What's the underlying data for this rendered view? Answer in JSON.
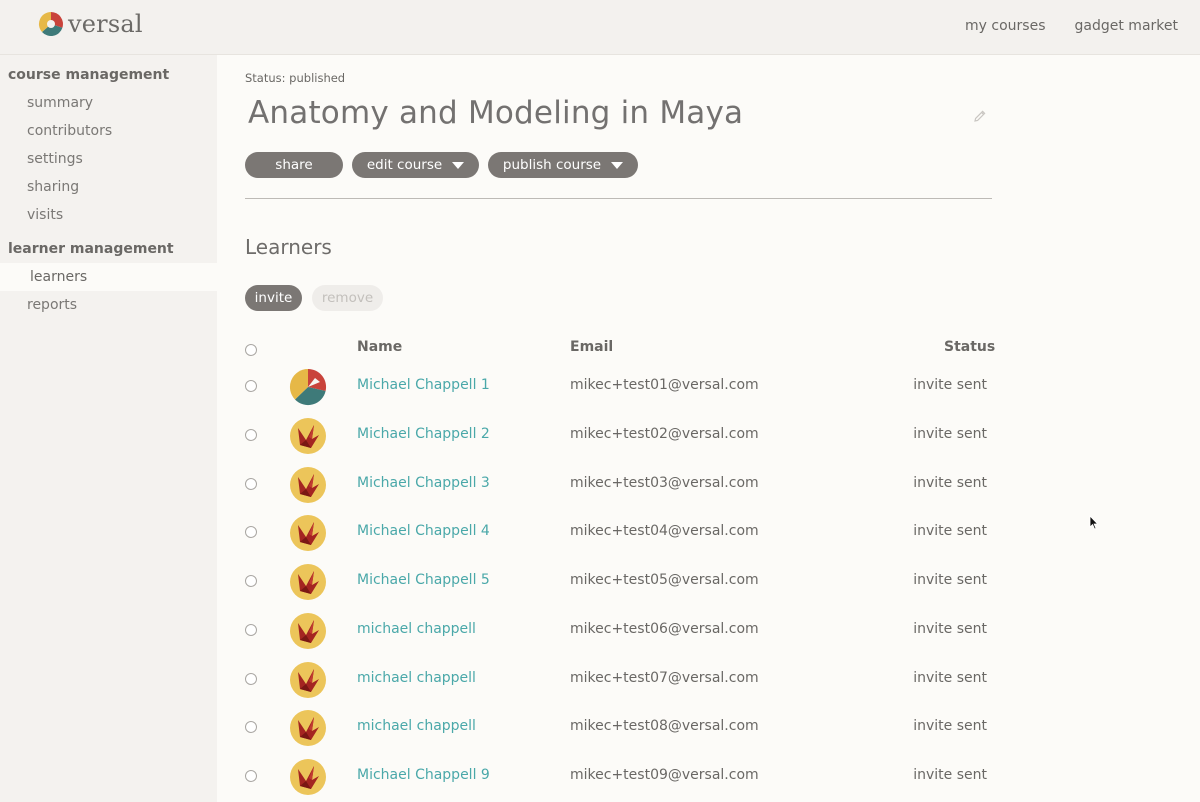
{
  "header": {
    "logo_text": "versal",
    "nav": [
      "my courses",
      "gadget market"
    ]
  },
  "sidebar": {
    "sections": [
      {
        "title": "course management",
        "items": [
          "summary",
          "contributors",
          "settings",
          "sharing",
          "visits"
        ]
      },
      {
        "title": "learner management",
        "items": [
          "learners",
          "reports"
        ]
      }
    ],
    "active_item": "learners"
  },
  "course": {
    "status": "Status: published",
    "title": "Anatomy and Modeling in Maya",
    "buttons": {
      "share": "share",
      "edit": "edit course",
      "publish": "publish course"
    }
  },
  "learners": {
    "title": "Learners",
    "invite_label": "invite",
    "remove_label": "remove",
    "columns": {
      "name": "Name",
      "email": "Email",
      "status": "Status"
    },
    "rows": [
      {
        "name": "Michael Chappell 1",
        "email": "mikec+test01@versal.com",
        "status": "invite sent",
        "avatar": "versal-logo"
      },
      {
        "name": "Michael Chappell 2",
        "email": "mikec+test02@versal.com",
        "status": "invite sent",
        "avatar": "origami-bird"
      },
      {
        "name": "Michael Chappell 3",
        "email": "mikec+test03@versal.com",
        "status": "invite sent",
        "avatar": "origami-bird"
      },
      {
        "name": "Michael Chappell 4",
        "email": "mikec+test04@versal.com",
        "status": "invite sent",
        "avatar": "origami-bird"
      },
      {
        "name": "Michael Chappell 5",
        "email": "mikec+test05@versal.com",
        "status": "invite sent",
        "avatar": "origami-bird"
      },
      {
        "name": "michael chappell",
        "email": "mikec+test06@versal.com",
        "status": "invite sent",
        "avatar": "origami-bird"
      },
      {
        "name": "michael chappell",
        "email": "mikec+test07@versal.com",
        "status": "invite sent",
        "avatar": "origami-bird"
      },
      {
        "name": "michael chappell",
        "email": "mikec+test08@versal.com",
        "status": "invite sent",
        "avatar": "origami-bird"
      },
      {
        "name": "Michael Chappell 9",
        "email": "mikec+test09@versal.com",
        "status": "invite sent",
        "avatar": "origami-bird"
      }
    ]
  },
  "colors": {
    "accent_link": "#4aa8a9",
    "pill": "#7b7774",
    "avatar_bg": "#ecc55a",
    "avatar_bird": "#a42521"
  }
}
